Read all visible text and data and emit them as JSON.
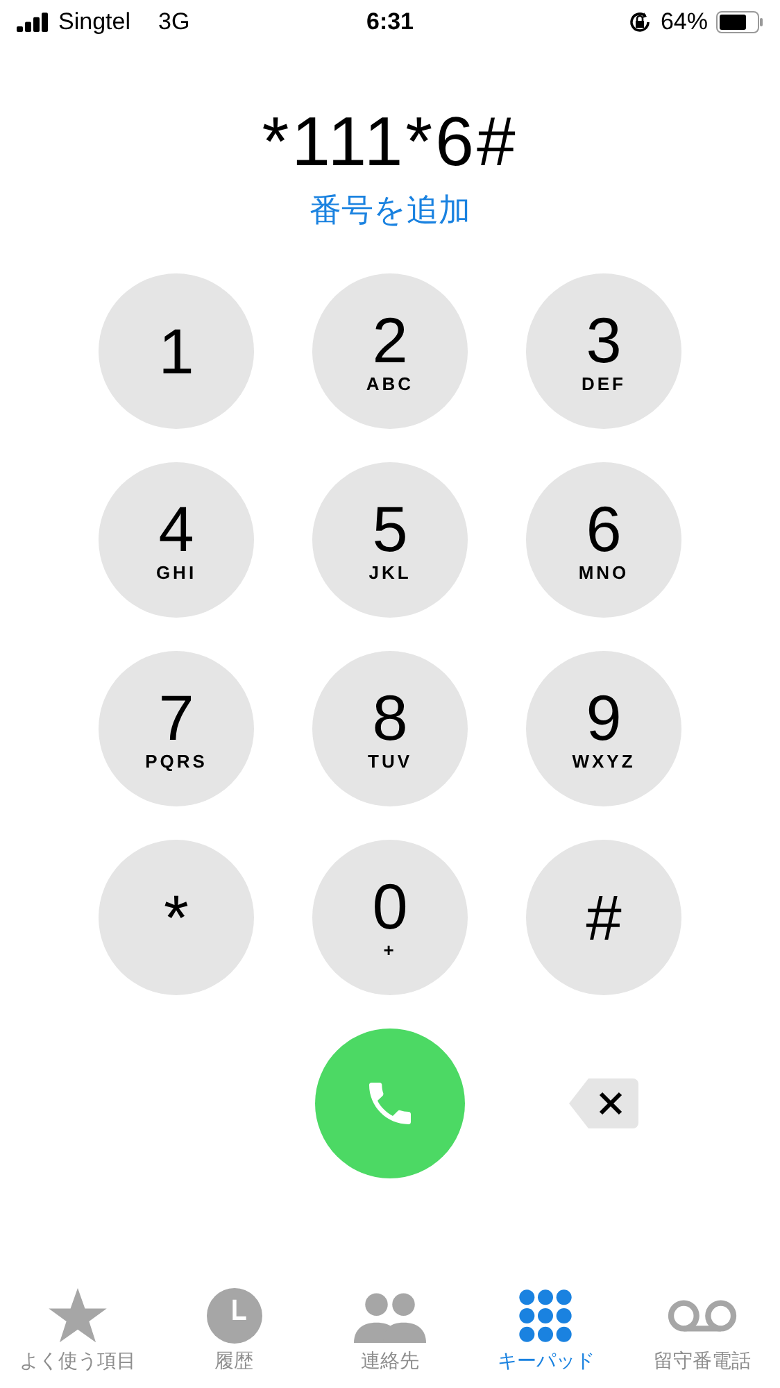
{
  "status_bar": {
    "carrier": "Singtel",
    "network": "3G",
    "time": "6:31",
    "battery": "64%"
  },
  "dialed_number": "*111*6#",
  "add_number_link": "番号を追加",
  "keys": [
    {
      "digit": "1"
    },
    {
      "digit": "2",
      "letters": "ABC"
    },
    {
      "digit": "3",
      "letters": "DEF"
    },
    {
      "digit": "4",
      "letters": "GHI"
    },
    {
      "digit": "5",
      "letters": "JKL"
    },
    {
      "digit": "6",
      "letters": "MNO"
    },
    {
      "digit": "7",
      "letters": "PQRS"
    },
    {
      "digit": "8",
      "letters": "TUV"
    },
    {
      "digit": "9",
      "letters": "WXYZ"
    },
    {
      "digit": "*"
    },
    {
      "digit": "0",
      "letters": "+"
    },
    {
      "digit": "#"
    }
  ],
  "tabs": [
    {
      "kind": "favorites",
      "label": "よく使う項目",
      "selected": false
    },
    {
      "kind": "recents",
      "label": "履歴",
      "selected": false
    },
    {
      "kind": "contacts",
      "label": "連絡先",
      "selected": false
    },
    {
      "kind": "keypad",
      "label": "キーパッド",
      "selected": true
    },
    {
      "kind": "voicemail",
      "label": "留守番電話",
      "selected": false
    }
  ]
}
